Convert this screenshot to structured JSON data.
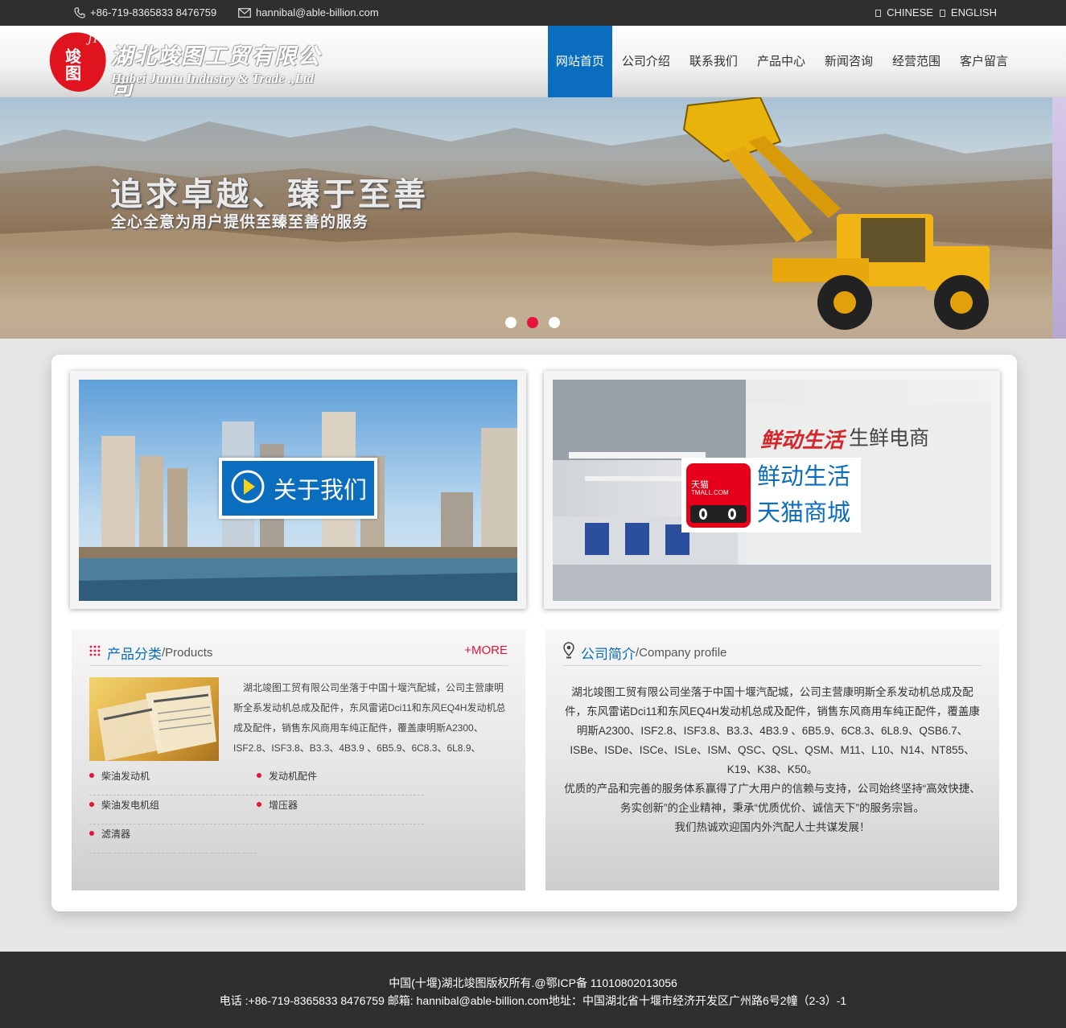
{
  "topbar": {
    "phone": "+86-719-8365833 8476759",
    "email": "hannibal@able-billion.com",
    "lang_cn": "CHINESE",
    "lang_en": "ENGLISH"
  },
  "logo": {
    "mark_letters": "JT",
    "mark_cn": "竣图",
    "name_cn": "湖北竣图工贸有限公司",
    "name_en": "Hubei Juntu Industry & Trade .,Ltd"
  },
  "nav": {
    "items": [
      "网站首页",
      "公司介绍",
      "联系我们",
      "产品中心",
      "新闻咨询",
      "经营范围",
      "客户留言"
    ],
    "active_index": 0
  },
  "banner": {
    "slogan": "追求卓越、臻于至善",
    "subtitle": "全心全意为用户提供至臻至善的服务",
    "slide_count": 3,
    "active_slide": 2
  },
  "about": {
    "button_label": "关于我们"
  },
  "tmall": {
    "logo_cn": "天猫",
    "logo_en": "TMALL.COM",
    "line1": "鲜动生活",
    "line2": "天猫商城",
    "wall_brand": "鲜动生活",
    "wall_sub": "生鲜电商"
  },
  "products": {
    "title_cn": "产品分类",
    "title_en": "/Products",
    "more": "+MORE",
    "description": "湖北竣图工贸有限公司坐落于中国十堰汽配城，公司主营康明斯全系发动机总成及配件，东风雷诺Dci11和东风EQ4H发动机总成及配件，销售东风商用车纯正配件，覆盖康明斯A2300、ISF2.8、ISF3.8、B3.3、4B3.9 、6B5.9、6C8.3、6L8.9、",
    "categories": [
      "柴油发动机",
      "发动机配件",
      "柴油发电机组",
      "增压器",
      "滤清器"
    ]
  },
  "profile": {
    "title_cn": "公司简介",
    "title_en": "/Company profile",
    "paragraphs": [
      "湖北竣图工贸有限公司坐落于中国十堰汽配城，公司主营康明斯全系发动机总成及配件，东风雷诺Dci11和东风EQ4H发动机总成及配件，销售东风商用车纯正配件，覆盖康明斯A2300、ISF2.8、ISF3.8、B3.3、4B3.9 、6B5.9、6C8.3、6L8.9、QSB6.7、ISBe、ISDe、ISCe、ISLe、ISM、QSC、QSL、QSM、M11、L10、N14、NT855、K19、K38、K50。",
      "优质的产品和完善的服务体系赢得了广大用户的信赖与支持，公司始终坚持“高效快捷、务实创新”的企业精神，秉承“优质优价、诚信天下”的服务宗旨。",
      "我们热诚欢迎国内外汽配人士共谋发展！"
    ]
  },
  "footer": {
    "line1": "中国(十堰)湖北竣图版权所有.@鄂ICP备 11010802013056",
    "line2": "电话 :+86-719-8365833 8476759 邮箱: hannibal@able-billion.com地址：中国湖北省十堰市经济开发区广州路6号2幢（2-3）-1"
  },
  "colors": {
    "accent_blue": "#0a6dbd",
    "accent_red": "#e6143a",
    "dark_bar": "#2f2f2f"
  }
}
